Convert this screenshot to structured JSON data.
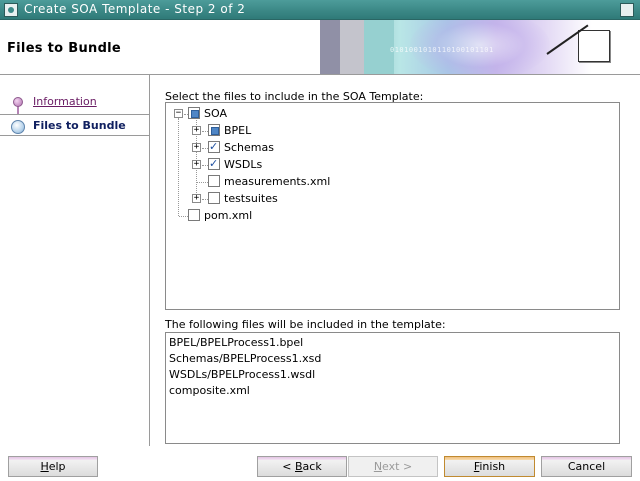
{
  "window": {
    "title": "Create SOA Template - Step 2 of 2",
    "icon": "app-icon",
    "close_icon": "close-icon"
  },
  "header": {
    "title": "Files to Bundle",
    "banner_text": "0101001010110100101101"
  },
  "nav": {
    "items": [
      {
        "label": "Information",
        "state": "visited",
        "icon": "step-dot-icon"
      },
      {
        "label": "Files to Bundle",
        "state": "current",
        "icon": "step-current-icon"
      }
    ]
  },
  "content": {
    "select_label": "Select the files to include in the SOA Template:",
    "tree": {
      "root": {
        "label": "SOA",
        "check": "partial",
        "expanded": true
      },
      "children": [
        {
          "label": "BPEL",
          "check": "partial",
          "expandable": true
        },
        {
          "label": "Schemas",
          "check": "checked",
          "expandable": true
        },
        {
          "label": "WSDLs",
          "check": "checked",
          "expandable": true
        },
        {
          "label": "measurements.xml",
          "check": "unchecked",
          "expandable": false
        },
        {
          "label": "testsuites",
          "check": "unchecked",
          "expandable": true
        }
      ],
      "sibling": {
        "label": "pom.xml",
        "check": "unchecked"
      }
    },
    "included_label": "The following files will be included in the template:",
    "included_files": [
      "BPEL/BPELProcess1.bpel",
      "Schemas/BPELProcess1.xsd",
      "WSDLs/BPELProcess1.wsdl",
      "composite.xml"
    ]
  },
  "buttons": {
    "help": {
      "mnemonic": "H",
      "rest": "elp"
    },
    "back": {
      "prefix": "< ",
      "mnemonic": "B",
      "rest": "ack"
    },
    "next": {
      "mnemonic": "N",
      "rest": "ext >",
      "enabled": false
    },
    "finish": {
      "mnemonic": "F",
      "rest": "inish"
    },
    "cancel": {
      "label": "Cancel"
    }
  }
}
